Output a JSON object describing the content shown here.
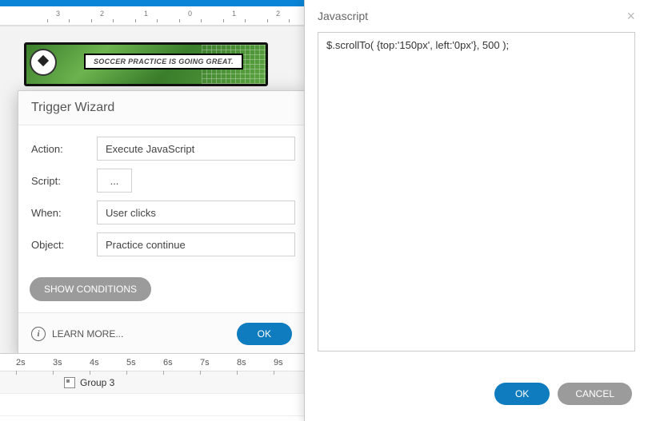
{
  "ruler": {
    "labels": [
      "3",
      "2",
      "1",
      "0",
      "1",
      "2"
    ]
  },
  "comic": {
    "speech_text": "SOCCER PRACTICE IS GOING GREAT."
  },
  "trigger_wizard": {
    "title": "Trigger Wizard",
    "rows": {
      "action": {
        "label": "Action:",
        "value": "Execute JavaScript"
      },
      "script": {
        "label": "Script:",
        "value": "..."
      },
      "when": {
        "label": "When:",
        "value": "User clicks"
      },
      "object": {
        "label": "Object:",
        "value": "Practice continue"
      }
    },
    "show_conditions": "SHOW CONDITIONS",
    "learn_more": "LEARN MORE...",
    "ok": "OK"
  },
  "javascript_dialog": {
    "title": "Javascript",
    "code": "$.scrollTo( {top:'150px', left:'0px'}, 500 );",
    "ok": "OK",
    "cancel": "CANCEL"
  },
  "timeline": {
    "seconds": [
      "2s",
      "3s",
      "4s",
      "5s",
      "6s",
      "7s",
      "8s",
      "9s"
    ],
    "row_label": "Group  3"
  }
}
